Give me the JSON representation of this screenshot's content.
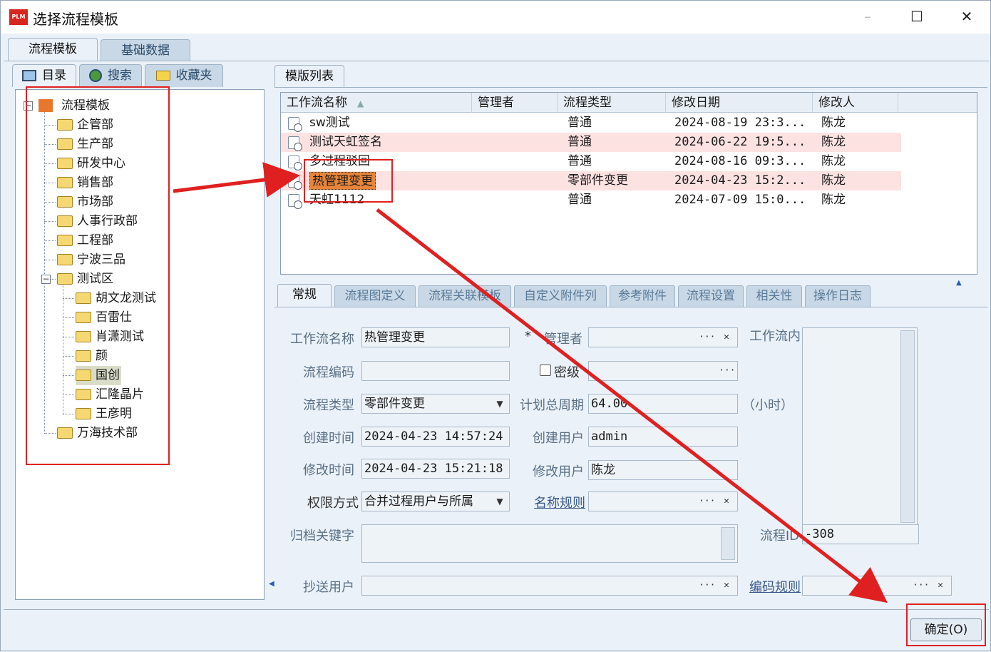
{
  "window": {
    "title": "选择流程模板",
    "logo_text": "PLM"
  },
  "top_tabs": [
    "流程模板",
    "基础数据"
  ],
  "sub_tabs": [
    "目录",
    "搜索",
    "收藏夹"
  ],
  "tree": {
    "root": "流程模板",
    "items": [
      "企管部",
      "生产部",
      "研发中心",
      "销售部",
      "市场部",
      "人事行政部",
      "工程部",
      "宁波三品",
      "测试区"
    ],
    "test_children": [
      "胡文龙测试",
      "百雷仕",
      "肖潇测试",
      "颜",
      "国创",
      "汇隆晶片",
      "王彦明"
    ],
    "last": "万海技术部"
  },
  "list_tab": "模版列表",
  "columns": [
    "工作流名称",
    "管理者",
    "流程类型",
    "修改日期",
    "修改人"
  ],
  "rows": [
    {
      "name": "sw测试",
      "type": "普通",
      "date": "2024-08-19 23:3...",
      "user": "陈龙"
    },
    {
      "name": "测试天虹签名",
      "type": "普通",
      "date": "2024-06-22 19:5...",
      "user": "陈龙"
    },
    {
      "name": "多过程驳回",
      "type": "普通",
      "date": "2024-08-16 09:3...",
      "user": "陈龙"
    },
    {
      "name": "热管理变更",
      "type": "零部件变更",
      "date": "2024-04-23 15:2...",
      "user": "陈龙"
    },
    {
      "name": "天虹1112",
      "type": "普通",
      "date": "2024-07-09 15:0...",
      "user": "陈龙"
    }
  ],
  "detail_tabs": [
    "常规",
    "流程图定义",
    "流程关联模板",
    "自定义附件列",
    "参考附件",
    "流程设置",
    "相关性",
    "操作日志"
  ],
  "form": {
    "name_label": "工作流名称",
    "name_value": "热管理变更",
    "manager_label": "管理者",
    "req_mark": "*",
    "content_label": "工作流内",
    "code_label": "流程编码",
    "secret_label": "密级",
    "type_label": "流程类型",
    "type_value": "零部件变更",
    "period_label": "计划总周期",
    "period_value": "64.00",
    "hours": "（小时）",
    "ctime_label": "创建时间",
    "ctime_value": "2024-04-23 14:57:24",
    "cuser_label": "创建用户",
    "cuser_value": "admin",
    "mtime_label": "修改时间",
    "mtime_value": "2024-04-23 15:21:18",
    "muser_label": "修改用户",
    "muser_value": "陈龙",
    "perm_label": "权限方式",
    "perm_value": "合并过程用户与所属",
    "naming_label": "名称规则",
    "archive_label": "归档关键字",
    "flowid_label": "流程ID",
    "flowid_value": "-308",
    "cc_label": "抄送用户",
    "coding_label": "编码规则"
  },
  "ok_button": "确定(O)",
  "colors": {
    "annotation": "#e02020",
    "selected_row": "#e8853a",
    "highlight_row": "#fde2e2"
  }
}
